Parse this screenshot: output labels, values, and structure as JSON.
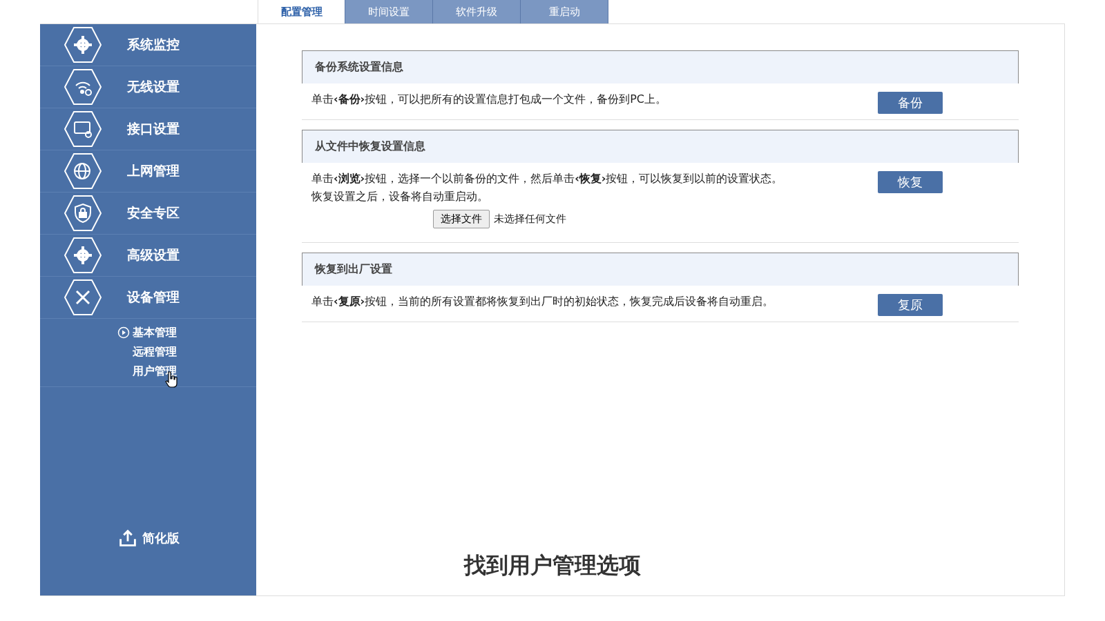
{
  "tabs": [
    {
      "label": "配置管理",
      "selected": true
    },
    {
      "label": "时间设置",
      "selected": false
    },
    {
      "label": "软件升级",
      "selected": false
    },
    {
      "label": "重启动",
      "selected": false
    }
  ],
  "sidebar": {
    "items": [
      {
        "label": "系统监控"
      },
      {
        "label": "无线设置"
      },
      {
        "label": "接口设置"
      },
      {
        "label": "上网管理"
      },
      {
        "label": "安全专区"
      },
      {
        "label": "高级设置"
      },
      {
        "label": "设备管理",
        "children": [
          {
            "label": "基本管理",
            "selected": true
          },
          {
            "label": "远程管理",
            "selected": false
          },
          {
            "label": "用户管理",
            "selected": false
          }
        ]
      }
    ],
    "footer": "简化版"
  },
  "sections": [
    {
      "title": "备份系统设置信息",
      "description": "单击**‹备份›**按钮，可以把所有的设置信息打包成一个文件，备份到PC上。",
      "button": "备份"
    },
    {
      "title": "从文件中恢复设置信息",
      "description": "单击**‹浏览›**按钮，选择一个以前备份的文件，然后单击**‹恢复›**按钮，可以恢复到以前的设置状态。恢复设置之后，设备将自动重启动。",
      "button": "恢复",
      "file_chooser": {
        "button": "选择文件",
        "status": "未选择任何文件"
      }
    },
    {
      "title": "恢复到出厂设置",
      "description": "单击**‹复原›**按钮，当前的所有设置都将恢复到出厂时的初始状态，恢复完成后设备将自动重启。",
      "button": "复原"
    }
  ],
  "caption": "找到用户管理选项"
}
